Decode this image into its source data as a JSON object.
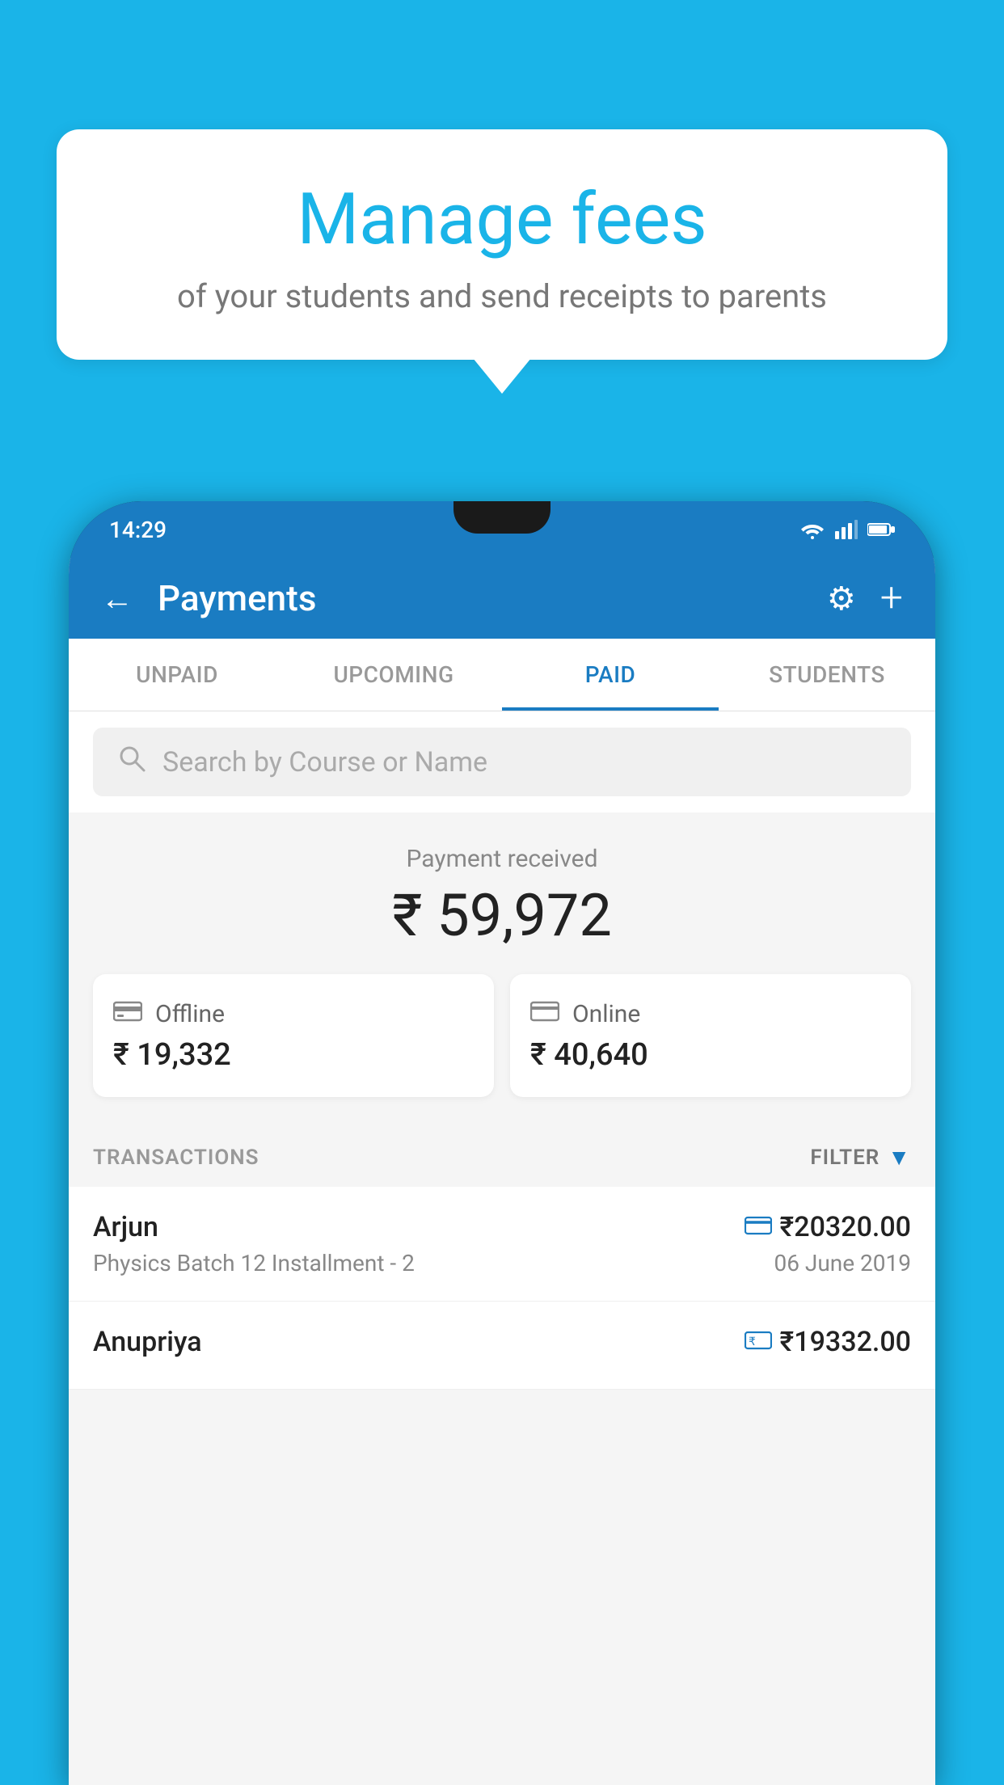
{
  "background_color": "#1ab4e8",
  "speech_bubble": {
    "title": "Manage fees",
    "subtitle": "of your students and send receipts to parents"
  },
  "status_bar": {
    "time": "14:29",
    "icons": [
      "wifi",
      "signal",
      "battery"
    ]
  },
  "header": {
    "title": "Payments",
    "back_label": "←",
    "settings_label": "⚙",
    "add_label": "+"
  },
  "tabs": [
    {
      "label": "UNPAID",
      "active": false
    },
    {
      "label": "UPCOMING",
      "active": false
    },
    {
      "label": "PAID",
      "active": true
    },
    {
      "label": "STUDENTS",
      "active": false
    }
  ],
  "search": {
    "placeholder": "Search by Course or Name"
  },
  "payment_summary": {
    "label": "Payment received",
    "amount": "₹ 59,972",
    "offline": {
      "type": "Offline",
      "amount": "₹ 19,332"
    },
    "online": {
      "type": "Online",
      "amount": "₹ 40,640"
    }
  },
  "transactions": {
    "label": "TRANSACTIONS",
    "filter_label": "FILTER",
    "items": [
      {
        "name": "Arjun",
        "course": "Physics Batch 12 Installment - 2",
        "amount": "₹20320.00",
        "date": "06 June 2019",
        "type": "online"
      },
      {
        "name": "Anupriya",
        "course": "",
        "amount": "₹19332.00",
        "date": "",
        "type": "offline"
      }
    ]
  }
}
